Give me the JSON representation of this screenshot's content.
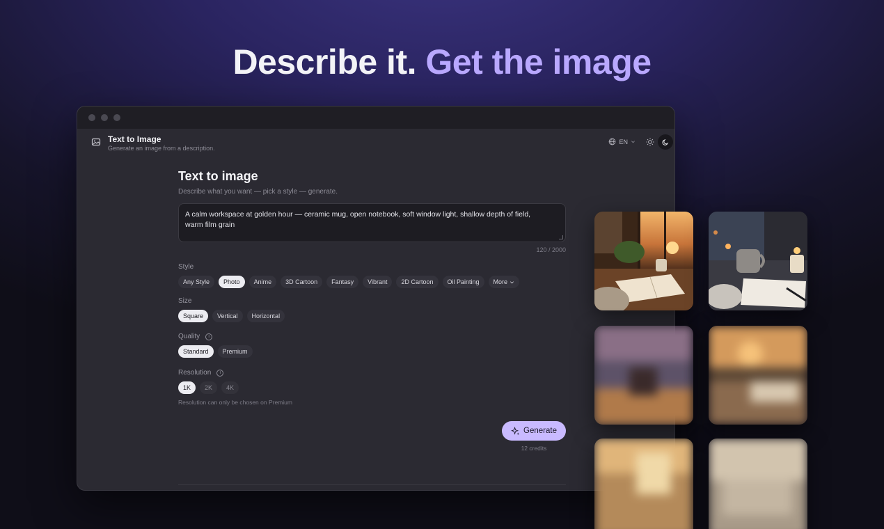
{
  "hero": {
    "lead": "Describe it.",
    "accent": "Get the image"
  },
  "app": {
    "title": "Text to Image",
    "subtitle": "Generate an image from a description.",
    "language": "EN"
  },
  "form": {
    "title": "Text to image",
    "subtitle": "Describe what you want — pick a style — generate.",
    "prompt_line1": "A calm workspace at golden hour — ceramic mug, open notebook, soft window light, shallow depth of field,",
    "prompt_line2": "warm film grain",
    "char_count": "120 / 2000",
    "style_label": "Style",
    "styles": [
      "Any Style",
      "Photo",
      "Anime",
      "3D Cartoon",
      "Fantasy",
      "Vibrant",
      "2D Cartoon",
      "Oil Painting",
      "More"
    ],
    "size_label": "Size",
    "sizes": [
      "Square",
      "Vertical",
      "Horizontal"
    ],
    "quality_label": "Quality",
    "qualities": [
      "Standard",
      "Premium"
    ],
    "resolution_label": "Resolution",
    "resolutions": [
      "1K",
      "2K",
      "4K"
    ],
    "resolution_note": "Resolution can only be chosen on Premium",
    "generate_label": "Generate",
    "credits": "12 credits"
  },
  "colors": {
    "accent": "#b9a8ff",
    "button": "#c9baff",
    "panel": "#2b2a32"
  },
  "icons": [
    "image-icon",
    "globe-icon",
    "chevron-down-icon",
    "sun-icon",
    "moon-icon",
    "info-icon",
    "sparkle-icon"
  ]
}
